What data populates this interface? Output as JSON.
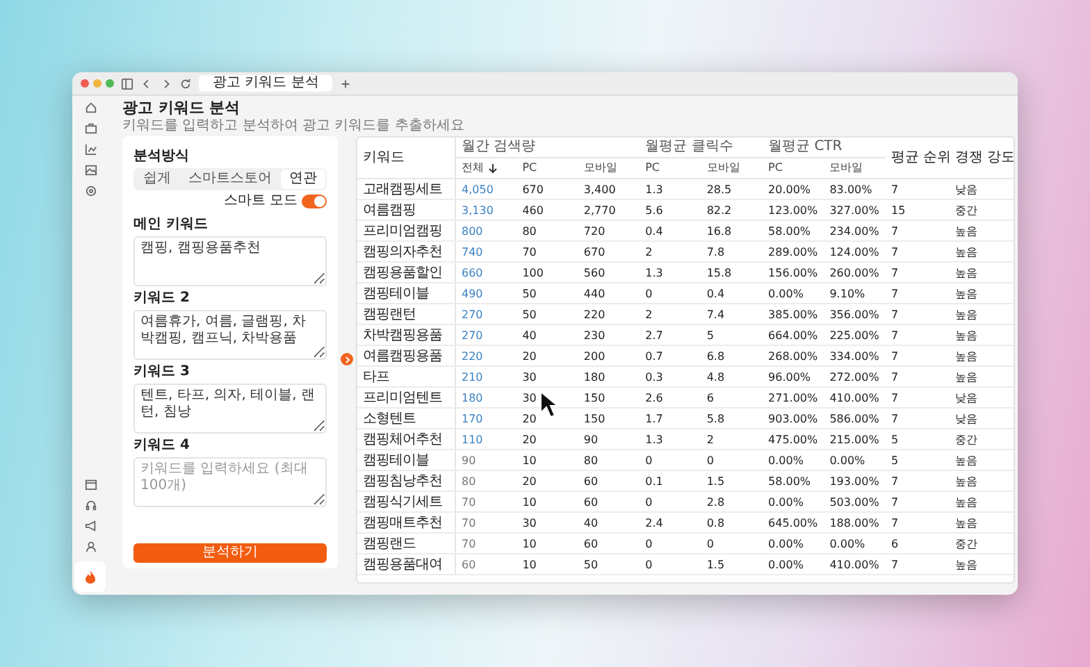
{
  "window": {
    "tab_title": "광고 키워드 분석"
  },
  "page": {
    "title": "광고 키워드 분석",
    "subtitle": "키워드를 입력하고 분석하여 광고 키워드를 추출하세요"
  },
  "analysis_panel": {
    "mode_label": "분석방식",
    "modes": [
      {
        "label": "쉽게",
        "selected": false
      },
      {
        "label": "스마트스토어",
        "selected": false
      },
      {
        "label": "연관",
        "selected": true
      }
    ],
    "toggle": {
      "label": "스마트 모드",
      "on": true
    },
    "fields": [
      {
        "label": "메인 키워드",
        "value": "캠핑, 캠핑용품추천"
      },
      {
        "label": "키워드 2",
        "value": "여름휴가, 여름, 글램핑, 차박캠핑, 캠프닉, 차박용품"
      },
      {
        "label": "키워드 3",
        "value": "텐트, 타프, 의자, 테이블, 랜턴, 침낭"
      },
      {
        "label": "키워드 4",
        "placeholder": "키워드를 입력하세요 (최대 100개)"
      }
    ],
    "submit_button": "분석하기"
  },
  "table": {
    "keyword_header": "키워드",
    "groups": [
      {
        "label": "월간 검색량",
        "columns": [
          {
            "label": "전체",
            "sorted": true
          },
          {
            "label": "PC",
            "sorted": false
          },
          {
            "label": "모바일",
            "sorted": false
          }
        ]
      },
      {
        "label": "월평균 클릭수",
        "columns": [
          {
            "label": "PC",
            "sorted": false
          },
          {
            "label": "모바일",
            "sorted": false
          }
        ]
      },
      {
        "label": "월평균 CTR",
        "columns": [
          {
            "label": "PC",
            "sorted": false
          },
          {
            "label": "모바일",
            "sorted": false
          }
        ]
      }
    ],
    "tail_headers": [
      "평균 순위",
      "경쟁 강도"
    ],
    "rows": [
      {
        "keyword": "고래캠핑세트",
        "highlight": true,
        "cells": [
          "4,050",
          "670",
          "3,400",
          "1.3",
          "28.5",
          "20.00%",
          "83.00%",
          "7",
          "낮음"
        ]
      },
      {
        "keyword": "여름캠핑",
        "highlight": true,
        "cells": [
          "3,130",
          "460",
          "2,770",
          "5.6",
          "82.2",
          "123.00%",
          "327.00%",
          "15",
          "중간"
        ]
      },
      {
        "keyword": "프리미엄캠핑",
        "highlight": true,
        "cells": [
          "800",
          "80",
          "720",
          "0.4",
          "16.8",
          "58.00%",
          "234.00%",
          "7",
          "높음"
        ]
      },
      {
        "keyword": "캠핑의자추천",
        "highlight": true,
        "cells": [
          "740",
          "70",
          "670",
          "2",
          "7.8",
          "289.00%",
          "124.00%",
          "7",
          "높음"
        ]
      },
      {
        "keyword": "캠핑용품할인",
        "highlight": true,
        "cells": [
          "660",
          "100",
          "560",
          "1.3",
          "15.8",
          "156.00%",
          "260.00%",
          "7",
          "높음"
        ]
      },
      {
        "keyword": "캠핑테이블",
        "highlight": true,
        "cells": [
          "490",
          "50",
          "440",
          "0",
          "0.4",
          "0.00%",
          "9.10%",
          "7",
          "높음"
        ]
      },
      {
        "keyword": "캠핑랜턴",
        "highlight": true,
        "cells": [
          "270",
          "50",
          "220",
          "2",
          "7.4",
          "385.00%",
          "356.00%",
          "7",
          "높음"
        ]
      },
      {
        "keyword": "차박캠핑용품",
        "highlight": true,
        "cells": [
          "270",
          "40",
          "230",
          "2.7",
          "5",
          "664.00%",
          "225.00%",
          "7",
          "높음"
        ]
      },
      {
        "keyword": "여름캠핑용품",
        "highlight": true,
        "cells": [
          "220",
          "20",
          "200",
          "0.7",
          "6.8",
          "268.00%",
          "334.00%",
          "7",
          "높음"
        ]
      },
      {
        "keyword": "타프",
        "highlight": true,
        "cells": [
          "210",
          "30",
          "180",
          "0.3",
          "4.8",
          "96.00%",
          "272.00%",
          "7",
          "높음"
        ]
      },
      {
        "keyword": "프리미엄텐트",
        "highlight": true,
        "cells": [
          "180",
          "30",
          "150",
          "2.6",
          "6",
          "271.00%",
          "410.00%",
          "7",
          "낮음"
        ]
      },
      {
        "keyword": "소형텐트",
        "highlight": true,
        "cells": [
          "170",
          "20",
          "150",
          "1.7",
          "5.8",
          "903.00%",
          "586.00%",
          "7",
          "낮음"
        ]
      },
      {
        "keyword": "캠핑체어추천",
        "highlight": true,
        "cells": [
          "110",
          "20",
          "90",
          "1.3",
          "2",
          "475.00%",
          "215.00%",
          "5",
          "중간"
        ]
      },
      {
        "keyword": "캠핑테이블",
        "highlight": false,
        "cells": [
          "90",
          "10",
          "80",
          "0",
          "0",
          "0.00%",
          "0.00%",
          "5",
          "높음"
        ]
      },
      {
        "keyword": "캠핑침낭추천",
        "highlight": false,
        "cells": [
          "80",
          "20",
          "60",
          "0.1",
          "1.5",
          "58.00%",
          "193.00%",
          "7",
          "높음"
        ]
      },
      {
        "keyword": "캠핑식기세트",
        "highlight": false,
        "cells": [
          "70",
          "10",
          "60",
          "0",
          "2.8",
          "0.00%",
          "503.00%",
          "7",
          "높음"
        ]
      },
      {
        "keyword": "캠핑매트추천",
        "highlight": false,
        "cells": [
          "70",
          "30",
          "40",
          "2.4",
          "0.8",
          "645.00%",
          "188.00%",
          "7",
          "높음"
        ]
      },
      {
        "keyword": "캠핑랜드",
        "highlight": false,
        "cells": [
          "70",
          "10",
          "60",
          "0",
          "0",
          "0.00%",
          "0.00%",
          "6",
          "중간"
        ]
      },
      {
        "keyword": "캠핑용품대여",
        "highlight": false,
        "cells": [
          "60",
          "10",
          "50",
          "0",
          "1.5",
          "0.00%",
          "410.00%",
          "7",
          "높음"
        ]
      }
    ]
  }
}
